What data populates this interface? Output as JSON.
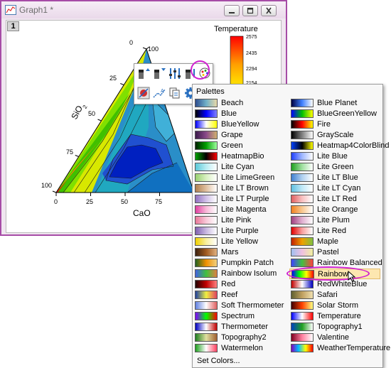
{
  "window": {
    "title": "Graph1 *",
    "layer_number": "1"
  },
  "colors": {
    "window_border": "#a64ca6",
    "highlight_ring": "#d020d0",
    "selected_item_bg": "#fde7b0"
  },
  "icons": [
    "graph-window-icon",
    "minimize-icon",
    "maximize-icon",
    "close-icon",
    "decrease-levels-icon",
    "increase-levels-icon",
    "adjust-levels-icon",
    "level-bars-icon",
    "palette-icon",
    "color-fill-icon",
    "line-style-icon",
    "copy-format-icon",
    "gear-icon",
    "mouse-cursor-icon"
  ],
  "chart_data": {
    "type": "heatmap",
    "subtype": "ternary contour",
    "bottom_axis": {
      "label": "CaO",
      "ticks": [
        "0",
        "25",
        "50",
        "75"
      ]
    },
    "left_axis": {
      "label": "SiO",
      "label_subscript": "2",
      "ticks": [
        "100",
        "75",
        "50",
        "25",
        "0"
      ]
    },
    "right_axis": {
      "ticks": [
        "100"
      ]
    },
    "colorbar": {
      "title": "Temperature",
      "ticks": [
        "2575",
        "2435",
        "2294",
        "2154"
      ]
    },
    "grid": false
  },
  "palettes_menu": {
    "header": "Palettes",
    "selected": "Rainbow",
    "set_colors_label": "Set Colors...",
    "left_column": [
      {
        "name": "Beach",
        "colors": [
          "#2e4d8f",
          "#6fb0c8",
          "#e8d9a8"
        ]
      },
      {
        "name": "Blue",
        "colors": [
          "#000000",
          "#0000ff",
          "#8080ff"
        ]
      },
      {
        "name": "BlueYellow",
        "colors": [
          "#0000ff",
          "#ffffff",
          "#ffff00"
        ]
      },
      {
        "name": "Grape",
        "colors": [
          "#3a1a4a",
          "#8a4a8a",
          "#d0b070"
        ]
      },
      {
        "name": "Green",
        "colors": [
          "#002000",
          "#00a000",
          "#a0ffa0"
        ]
      },
      {
        "name": "HeatmapBio",
        "colors": [
          "#00a000",
          "#000000",
          "#ff0000"
        ]
      },
      {
        "name": "Lite Cyan",
        "colors": [
          "#5bc8d8",
          "#b8ecf2",
          "#ffffff"
        ]
      },
      {
        "name": "Lite LimeGreen",
        "colors": [
          "#98d070",
          "#d8f0c0",
          "#ffffff"
        ]
      },
      {
        "name": "Lite LT Brown",
        "colors": [
          "#b08050",
          "#e0c0a0",
          "#ffffff"
        ]
      },
      {
        "name": "Lite LT Purple",
        "colors": [
          "#9070c0",
          "#d0c0e8",
          "#ffffff"
        ]
      },
      {
        "name": "Lite Magenta",
        "colors": [
          "#e040a0",
          "#f8b8d8",
          "#ffffff"
        ]
      },
      {
        "name": "Lite Pink",
        "colors": [
          "#e87898",
          "#f8c8d8",
          "#ffffff"
        ]
      },
      {
        "name": "Lite Purple",
        "colors": [
          "#8060b0",
          "#c8b8e0",
          "#ffffff"
        ]
      },
      {
        "name": "Lite Yellow",
        "colors": [
          "#f0d000",
          "#f8f0a0",
          "#ffffff"
        ]
      },
      {
        "name": "Mars",
        "colors": [
          "#3a2010",
          "#a05a20",
          "#e0b080"
        ]
      },
      {
        "name": "Pumpkin Patch",
        "colors": [
          "#206020",
          "#f09000",
          "#f0d080"
        ]
      },
      {
        "name": "Rainbow Isolum",
        "colors": [
          "#4060e0",
          "#40c040",
          "#e08040"
        ]
      },
      {
        "name": "Red",
        "colors": [
          "#200000",
          "#c00000",
          "#ff8080"
        ]
      },
      {
        "name": "Reef",
        "colors": [
          "#2040a0",
          "#f0f040",
          "#e04060"
        ]
      },
      {
        "name": "Soft Thermometer",
        "colors": [
          "#6080e0",
          "#ffffff",
          "#e06060"
        ]
      },
      {
        "name": "Spectrum",
        "colors": [
          "#8000ff",
          "#00ff00",
          "#ff0000"
        ]
      },
      {
        "name": "Thermometer",
        "colors": [
          "#0000c0",
          "#ffffff",
          "#c00000"
        ]
      },
      {
        "name": "Topography2",
        "colors": [
          "#208020",
          "#e0e0a0",
          "#a06030"
        ]
      },
      {
        "name": "Watermelon",
        "colors": [
          "#20a020",
          "#ffffff",
          "#ff4060"
        ]
      }
    ],
    "right_column": [
      {
        "name": "Blue Planet",
        "colors": [
          "#000040",
          "#4080ff",
          "#ffffff"
        ]
      },
      {
        "name": "BlueGreenYellow",
        "colors": [
          "#0000ff",
          "#00c000",
          "#ffff00"
        ]
      },
      {
        "name": "Fire",
        "colors": [
          "#000000",
          "#ff0000",
          "#ffff00"
        ]
      },
      {
        "name": "GrayScale",
        "colors": [
          "#000000",
          "#808080",
          "#ffffff"
        ]
      },
      {
        "name": "Heatmap4ColorBlind",
        "colors": [
          "#0040ff",
          "#000000",
          "#ffff00"
        ]
      },
      {
        "name": "Lite Blue",
        "colors": [
          "#2040ff",
          "#a0b8ff",
          "#ffffff"
        ]
      },
      {
        "name": "Lite Green",
        "colors": [
          "#20a020",
          "#a0e0a0",
          "#ffffff"
        ]
      },
      {
        "name": "Lite LT Blue",
        "colors": [
          "#4080d0",
          "#b0d0f0",
          "#ffffff"
        ]
      },
      {
        "name": "Lite LT Cyan",
        "colors": [
          "#60c0e0",
          "#c0e8f8",
          "#ffffff"
        ]
      },
      {
        "name": "Lite LT Red",
        "colors": [
          "#e06060",
          "#f8c0c0",
          "#ffffff"
        ]
      },
      {
        "name": "Lite Orange",
        "colors": [
          "#f08020",
          "#f8c890",
          "#ffffff"
        ]
      },
      {
        "name": "Lite Plum",
        "colors": [
          "#a04080",
          "#e0b0d0",
          "#ffffff"
        ]
      },
      {
        "name": "Lite Red",
        "colors": [
          "#e00000",
          "#f8a0a0",
          "#ffffff"
        ]
      },
      {
        "name": "Maple",
        "colors": [
          "#c02000",
          "#f0a000",
          "#80c040"
        ]
      },
      {
        "name": "Pastel",
        "colors": [
          "#a0c0f0",
          "#f0c0e0",
          "#f0f0a0"
        ]
      },
      {
        "name": "Rainbow Balanced",
        "colors": [
          "#4040ff",
          "#40c040",
          "#ff4040"
        ]
      },
      {
        "name": "Rainbow",
        "colors": [
          "#0000ff",
          "#00ff00",
          "#ffff00",
          "#ff0000"
        ]
      },
      {
        "name": "RedWhiteBlue",
        "colors": [
          "#c00000",
          "#ffffff",
          "#0000c0"
        ]
      },
      {
        "name": "Safari",
        "colors": [
          "#606030",
          "#c0a060",
          "#f0e0b0"
        ]
      },
      {
        "name": "Solar Storm",
        "colors": [
          "#400000",
          "#ff4000",
          "#ffff80"
        ]
      },
      {
        "name": "Temperature",
        "colors": [
          "#0000ff",
          "#ffffff",
          "#ff0000"
        ]
      },
      {
        "name": "Topography1",
        "colors": [
          "#0040c0",
          "#20a020",
          "#ffffff"
        ]
      },
      {
        "name": "Valentine",
        "colors": [
          "#800020",
          "#ff80a0",
          "#ffffff"
        ]
      },
      {
        "name": "WeatherTemperature",
        "colors": [
          "#8000c0",
          "#00c0ff",
          "#ffff00",
          "#ff0000"
        ]
      }
    ]
  }
}
